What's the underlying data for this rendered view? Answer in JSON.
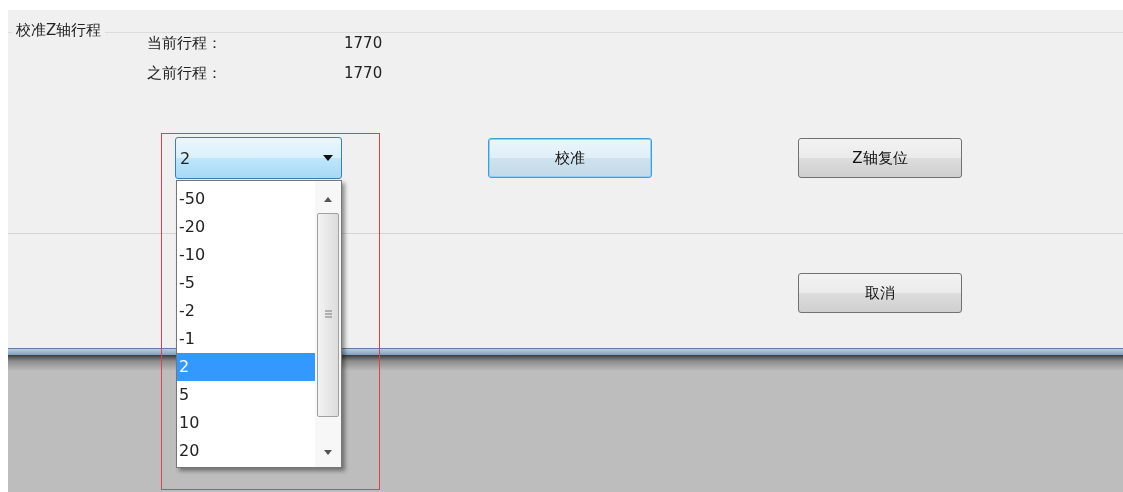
{
  "group": {
    "title": "校准Z轴行程",
    "readings": [
      {
        "label": "当前行程：",
        "value": "1770"
      },
      {
        "label": "之前行程：",
        "value": "1770"
      }
    ]
  },
  "step_combo": {
    "value": "2",
    "expanded": true,
    "options": [
      {
        "label": "-50",
        "selected": false
      },
      {
        "label": "-20",
        "selected": false
      },
      {
        "label": "-10",
        "selected": false
      },
      {
        "label": "-5",
        "selected": false
      },
      {
        "label": "-2",
        "selected": false
      },
      {
        "label": "-1",
        "selected": false
      },
      {
        "label": "2",
        "selected": true
      },
      {
        "label": "5",
        "selected": false
      },
      {
        "label": "10",
        "selected": false
      },
      {
        "label": "20",
        "selected": false
      }
    ]
  },
  "buttons": [
    {
      "label": "校准",
      "focused": true
    },
    {
      "label": "Z轴复位",
      "focused": false
    }
  ],
  "cancel_button": {
    "label": "取消"
  }
}
